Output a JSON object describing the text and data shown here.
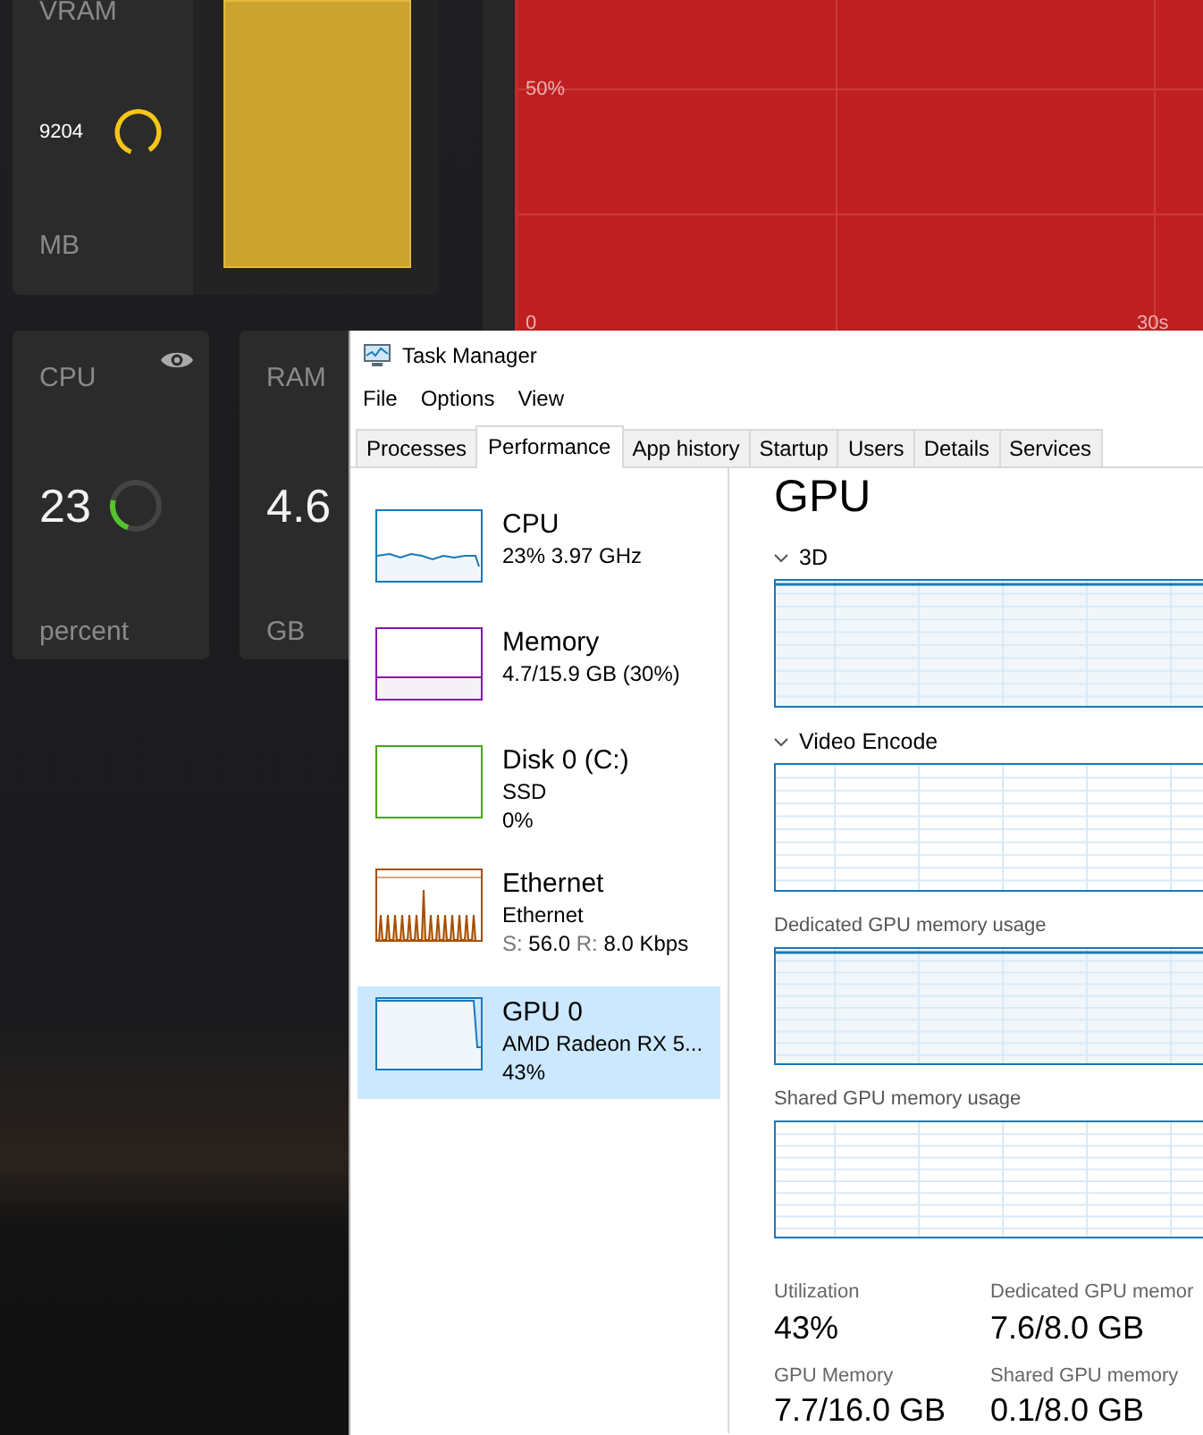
{
  "dashboard": {
    "vram_card": {
      "label": "VRAM",
      "value": "9204",
      "unit": "MB",
      "level": 0.85,
      "color": "#f5c518"
    },
    "graph": {
      "mid_label": "50%",
      "zero_label": "0",
      "time_label": "30s"
    },
    "cards": [
      {
        "label": "CPU",
        "value": "23",
        "unit": "percent",
        "level": 0.23,
        "color": "#55c52e",
        "watched": true
      },
      {
        "label": "RAM",
        "value": "4.6",
        "unit": "GB"
      }
    ]
  },
  "task_manager": {
    "title": "Task Manager",
    "menu": [
      "File",
      "Options",
      "View"
    ],
    "tabs": [
      {
        "label": "Processes",
        "selected": false
      },
      {
        "label": "Performance",
        "selected": true
      },
      {
        "label": "App history",
        "selected": false
      },
      {
        "label": "Startup",
        "selected": false
      },
      {
        "label": "Users",
        "selected": false
      },
      {
        "label": "Details",
        "selected": false
      },
      {
        "label": "Services",
        "selected": false
      }
    ],
    "resources": [
      {
        "kind": "line",
        "name": "CPU",
        "lines": [
          "23%  3.97 GHz"
        ],
        "color": "#1779ba",
        "selected": false
      },
      {
        "kind": "bar",
        "name": "Memory",
        "lines": [
          "4.7/15.9 GB (30%)"
        ],
        "color": "#8b12ae",
        "selected": false
      },
      {
        "kind": "empty",
        "name": "Disk 0 (C:)",
        "lines": [
          "SSD",
          "0%"
        ],
        "color": "#4da60c",
        "selected": false
      },
      {
        "kind": "spikes",
        "name": "Ethernet",
        "lines": [
          "Ethernet"
        ],
        "rate": {
          "send_label": "S:",
          "send": "56.0",
          "receive_label": "R:",
          "receive": "8.0 Kbps"
        },
        "color": "#a74f01",
        "selected": false
      },
      {
        "kind": "fill",
        "name": "GPU 0",
        "lines": [
          "AMD Radeon RX 5...",
          "43%"
        ],
        "color": "#1779ba",
        "selected": true
      }
    ],
    "heading": "GPU",
    "graphs": [
      {
        "label": "3D",
        "collapsible": true,
        "shaded": true
      },
      {
        "label": "Video Encode",
        "collapsible": true,
        "shaded": false
      },
      {
        "label": "Dedicated GPU memory usage",
        "collapsible": false,
        "shaded": true
      },
      {
        "label": "Shared GPU memory usage",
        "collapsible": false,
        "shaded": false
      }
    ],
    "stats": [
      {
        "label": "Utilization",
        "value": "43%"
      },
      {
        "label": "Dedicated GPU memor",
        "value": "7.6/8.0 GB"
      },
      {
        "label": "GPU Memory",
        "value": "7.7/16.0 GB"
      },
      {
        "label": "Shared GPU memory",
        "value": "0.1/8.0 GB"
      }
    ]
  }
}
